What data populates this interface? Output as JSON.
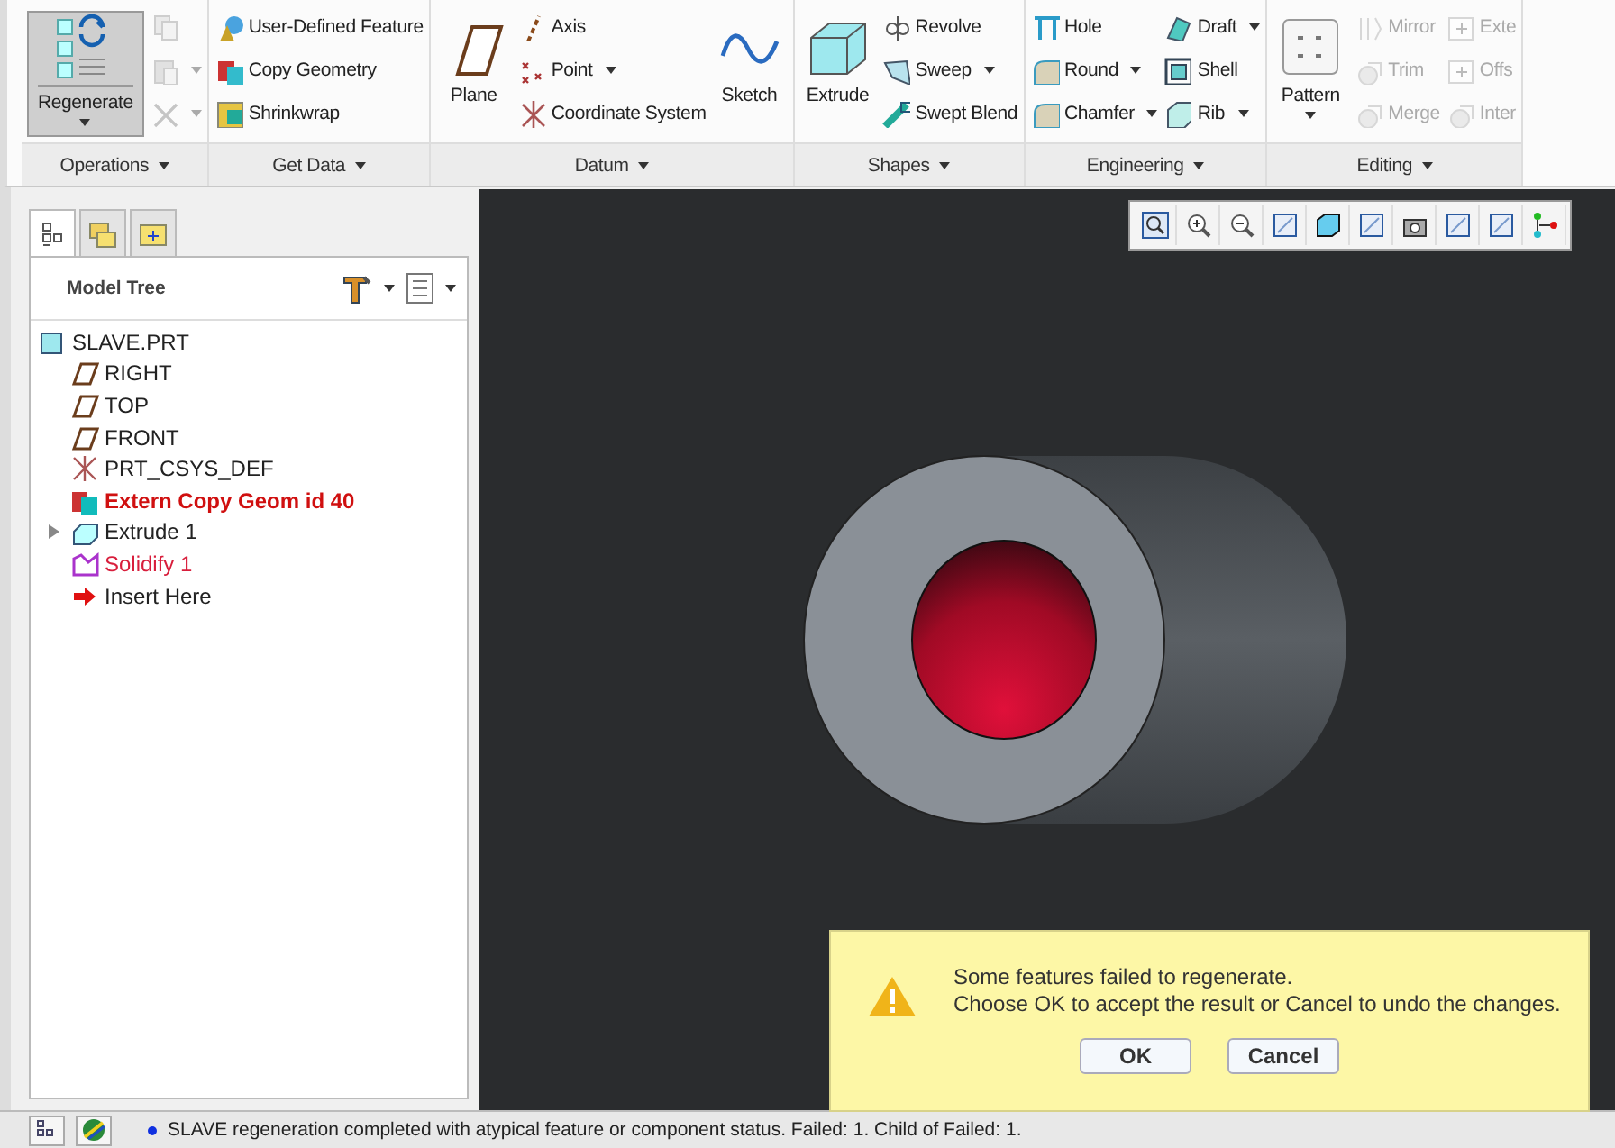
{
  "ribbon": {
    "groups": [
      {
        "label": "Operations",
        "columns": [
          {
            "kind": "large",
            "label": "Regenerate",
            "dropdown": true,
            "pressed": true
          },
          {
            "kind": "stack",
            "items": [
              {
                "dropdown": false,
                "disabled": true
              },
              {
                "dropdown": true,
                "disabled": true
              },
              {
                "dropdown": true,
                "disabled": true
              }
            ]
          }
        ]
      },
      {
        "label": "Get Data",
        "columns": [
          {
            "kind": "stack",
            "items": [
              {
                "label": "User-Defined Feature",
                "dropdown": false,
                "disabled": false
              },
              {
                "label": "Copy Geometry",
                "dropdown": false,
                "disabled": false
              },
              {
                "label": "Shrinkwrap",
                "dropdown": false,
                "disabled": false
              }
            ]
          }
        ]
      },
      {
        "label": "Datum",
        "columns": [
          {
            "kind": "large",
            "label": "Plane",
            "dropdown": false,
            "pressed": false
          },
          {
            "kind": "stack",
            "items": [
              {
                "label": "Axis",
                "dropdown": false,
                "disabled": false
              },
              {
                "label": "Point",
                "dropdown": true,
                "disabled": false
              },
              {
                "label": "Coordinate System",
                "dropdown": false,
                "disabled": false
              }
            ]
          },
          {
            "kind": "large",
            "label": "Sketch",
            "dropdown": false,
            "pressed": false
          }
        ]
      },
      {
        "label": "Shapes",
        "columns": [
          {
            "kind": "large",
            "label": "Extrude",
            "dropdown": false,
            "pressed": false
          },
          {
            "kind": "stack",
            "items": [
              {
                "label": "Revolve",
                "dropdown": false,
                "disabled": false
              },
              {
                "label": "Sweep",
                "dropdown": true,
                "disabled": false
              },
              {
                "label": "Swept Blend",
                "dropdown": false,
                "disabled": false
              }
            ]
          }
        ]
      },
      {
        "label": "Engineering",
        "columns": [
          {
            "kind": "stack",
            "items": [
              {
                "label": "Hole",
                "dropdown": false,
                "disabled": false
              },
              {
                "label": "Round",
                "dropdown": true,
                "disabled": false
              },
              {
                "label": "Chamfer",
                "dropdown": true,
                "disabled": false
              }
            ]
          },
          {
            "kind": "stack",
            "items": [
              {
                "label": "Draft",
                "dropdown": true,
                "disabled": false
              },
              {
                "label": "Shell",
                "dropdown": false,
                "disabled": false
              },
              {
                "label": "Rib",
                "dropdown": true,
                "disabled": false
              }
            ]
          }
        ]
      },
      {
        "label": "Editing",
        "columns": [
          {
            "kind": "large",
            "label": "Pattern",
            "dropdown": true,
            "pressed": false
          },
          {
            "kind": "stack",
            "items": [
              {
                "label": "Mirror",
                "dropdown": false,
                "disabled": true
              },
              {
                "label": "Trim",
                "dropdown": false,
                "disabled": true
              },
              {
                "label": "Merge",
                "dropdown": false,
                "disabled": true
              }
            ]
          },
          {
            "kind": "stack",
            "items": [
              {
                "label": "Exte",
                "dropdown": false,
                "disabled": true
              },
              {
                "label": "Offs",
                "dropdown": false,
                "disabled": true
              },
              {
                "label": "Inter",
                "dropdown": false,
                "disabled": true
              }
            ]
          }
        ]
      }
    ]
  },
  "panel": {
    "tabs": [
      {
        "kind": "tree",
        "selected": true
      },
      {
        "kind": "folders",
        "selected": false
      },
      {
        "kind": "favorites",
        "selected": false
      }
    ],
    "title": "Model Tree",
    "tree": [
      {
        "label": "SLAVE.PRT",
        "kind": "part",
        "failed": false,
        "child_failed": false,
        "children": [
          {
            "label": "RIGHT",
            "kind": "plane",
            "failed": false,
            "child_failed": false
          },
          {
            "label": "TOP",
            "kind": "plane",
            "failed": false,
            "child_failed": false
          },
          {
            "label": "FRONT",
            "kind": "plane",
            "failed": false,
            "child_failed": false
          },
          {
            "label": "PRT_CSYS_DEF",
            "kind": "csys",
            "failed": false,
            "child_failed": false
          },
          {
            "label": "Extern Copy Geom id 40",
            "kind": "copygeom",
            "failed": true,
            "child_failed": false
          },
          {
            "label": "Extrude 1",
            "kind": "extrude",
            "failed": false,
            "child_failed": false,
            "expanded": false
          },
          {
            "label": "Solidify 1",
            "kind": "solidify",
            "failed": false,
            "child_failed": true
          },
          {
            "label": "Insert Here",
            "kind": "insert",
            "failed": false,
            "child_failed": false
          }
        ]
      }
    ]
  },
  "dialog": {
    "lines": [
      "Some features failed to regenerate.",
      "Choose OK to accept the result or Cancel to undo the changes."
    ],
    "buttons": [
      "OK",
      "Cancel"
    ]
  },
  "status_bar": {
    "message": "SLAVE regeneration completed with atypical feature or component status. Failed: 1. Child of Failed: 1."
  }
}
